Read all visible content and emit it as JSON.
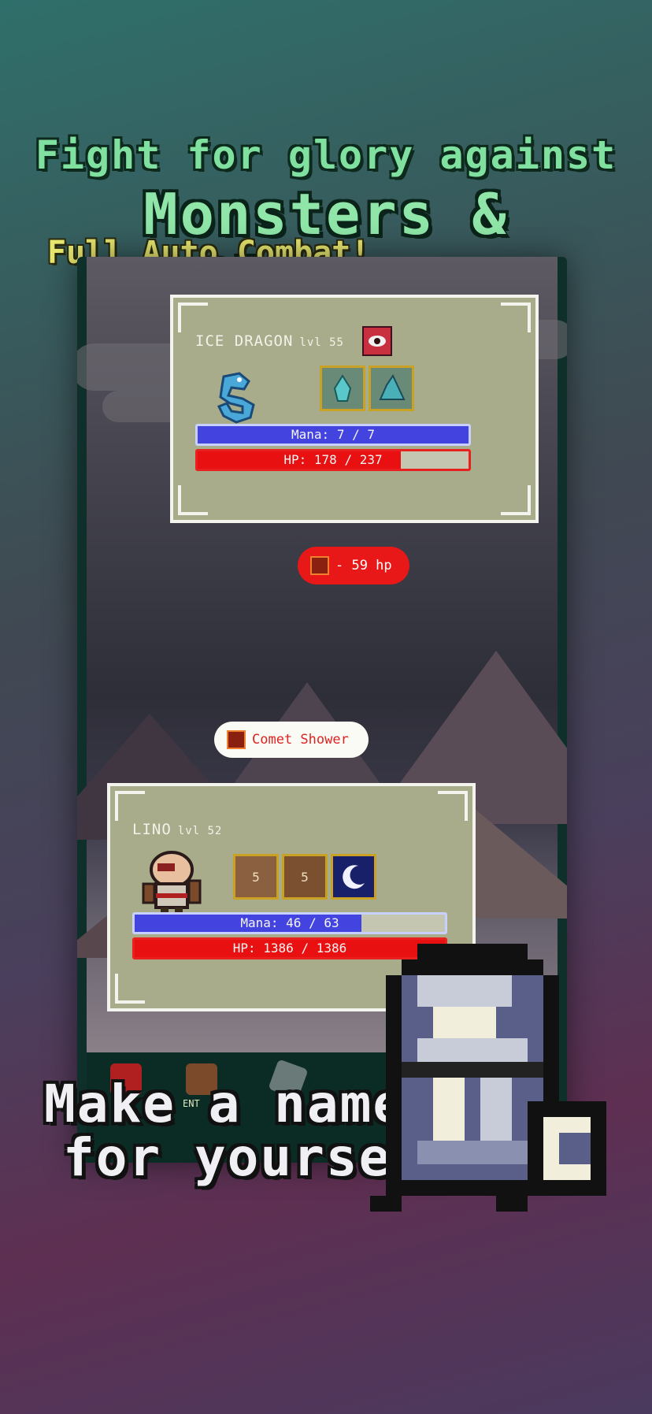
{
  "promo": {
    "line1": "Fight for glory against",
    "line2": "Monsters & Players",
    "line3": "Full Auto Combat!",
    "tagline_1": "Make a name",
    "tagline_2": "for yourself"
  },
  "enemy": {
    "name": "ICE DRAGON",
    "level": "lvl 55",
    "mana_text": "Mana: 7 / 7",
    "mana_fraction": 1.0,
    "hp_text": "HP: 178 / 237",
    "hp_fraction": 0.751
  },
  "damage_popup": "- 59 hp",
  "spell_popup": "Comet Shower",
  "pause_label": "II",
  "player": {
    "name": "LINO",
    "level": "lvl 52",
    "skill_counts": [
      "5",
      "5"
    ],
    "mana_text": "Mana: 46 / 63",
    "mana_fraction": 0.73,
    "hp_text": "HP: 1386 / 1386",
    "hp_fraction": 1.0
  },
  "nav_partial_label": "ENT",
  "colors": {
    "mana": "#4343e0",
    "hp": "#e81010",
    "panel": "#a9ac8a",
    "headline_green": "#8fe6a8",
    "headline_yellow": "#e8e870"
  }
}
